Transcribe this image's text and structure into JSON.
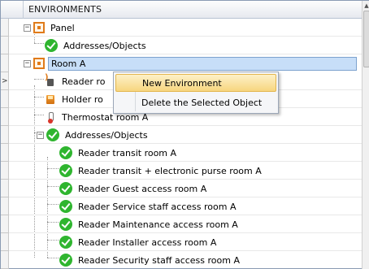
{
  "header": {
    "title": "ENVIRONMENTS"
  },
  "tree": {
    "rows": [
      {
        "label": "Panel",
        "kind": "panel"
      },
      {
        "label": "Addresses/Objects",
        "kind": "ok"
      },
      {
        "label": "Room A",
        "kind": "panel",
        "selected": true
      },
      {
        "label": "Reader ro",
        "kind": "reader"
      },
      {
        "label": "Holder ro",
        "kind": "holder"
      },
      {
        "label": "Thermostat room A",
        "kind": "thermo"
      },
      {
        "label": "Addresses/Objects",
        "kind": "ok"
      },
      {
        "label": "Reader transit room A",
        "kind": "ok"
      },
      {
        "label": "Reader transit + electronic purse room A",
        "kind": "ok"
      },
      {
        "label": "Reader Guest access room A",
        "kind": "ok"
      },
      {
        "label": "Reader Service staff access room A",
        "kind": "ok"
      },
      {
        "label": "Reader Maintenance access room A",
        "kind": "ok"
      },
      {
        "label": "Reader Installer access room A",
        "kind": "ok"
      },
      {
        "label": "Reader Security staff access room A",
        "kind": "ok"
      }
    ],
    "expander_minus": "−",
    "row_indicator": ">"
  },
  "context_menu": {
    "items": [
      {
        "label": "New Environment"
      },
      {
        "label": "Delete the Selected Object"
      }
    ]
  },
  "colors": {
    "accent_check": "#2fb52f",
    "panel_orange": "#e07b1a",
    "selection": "#c7def8"
  }
}
